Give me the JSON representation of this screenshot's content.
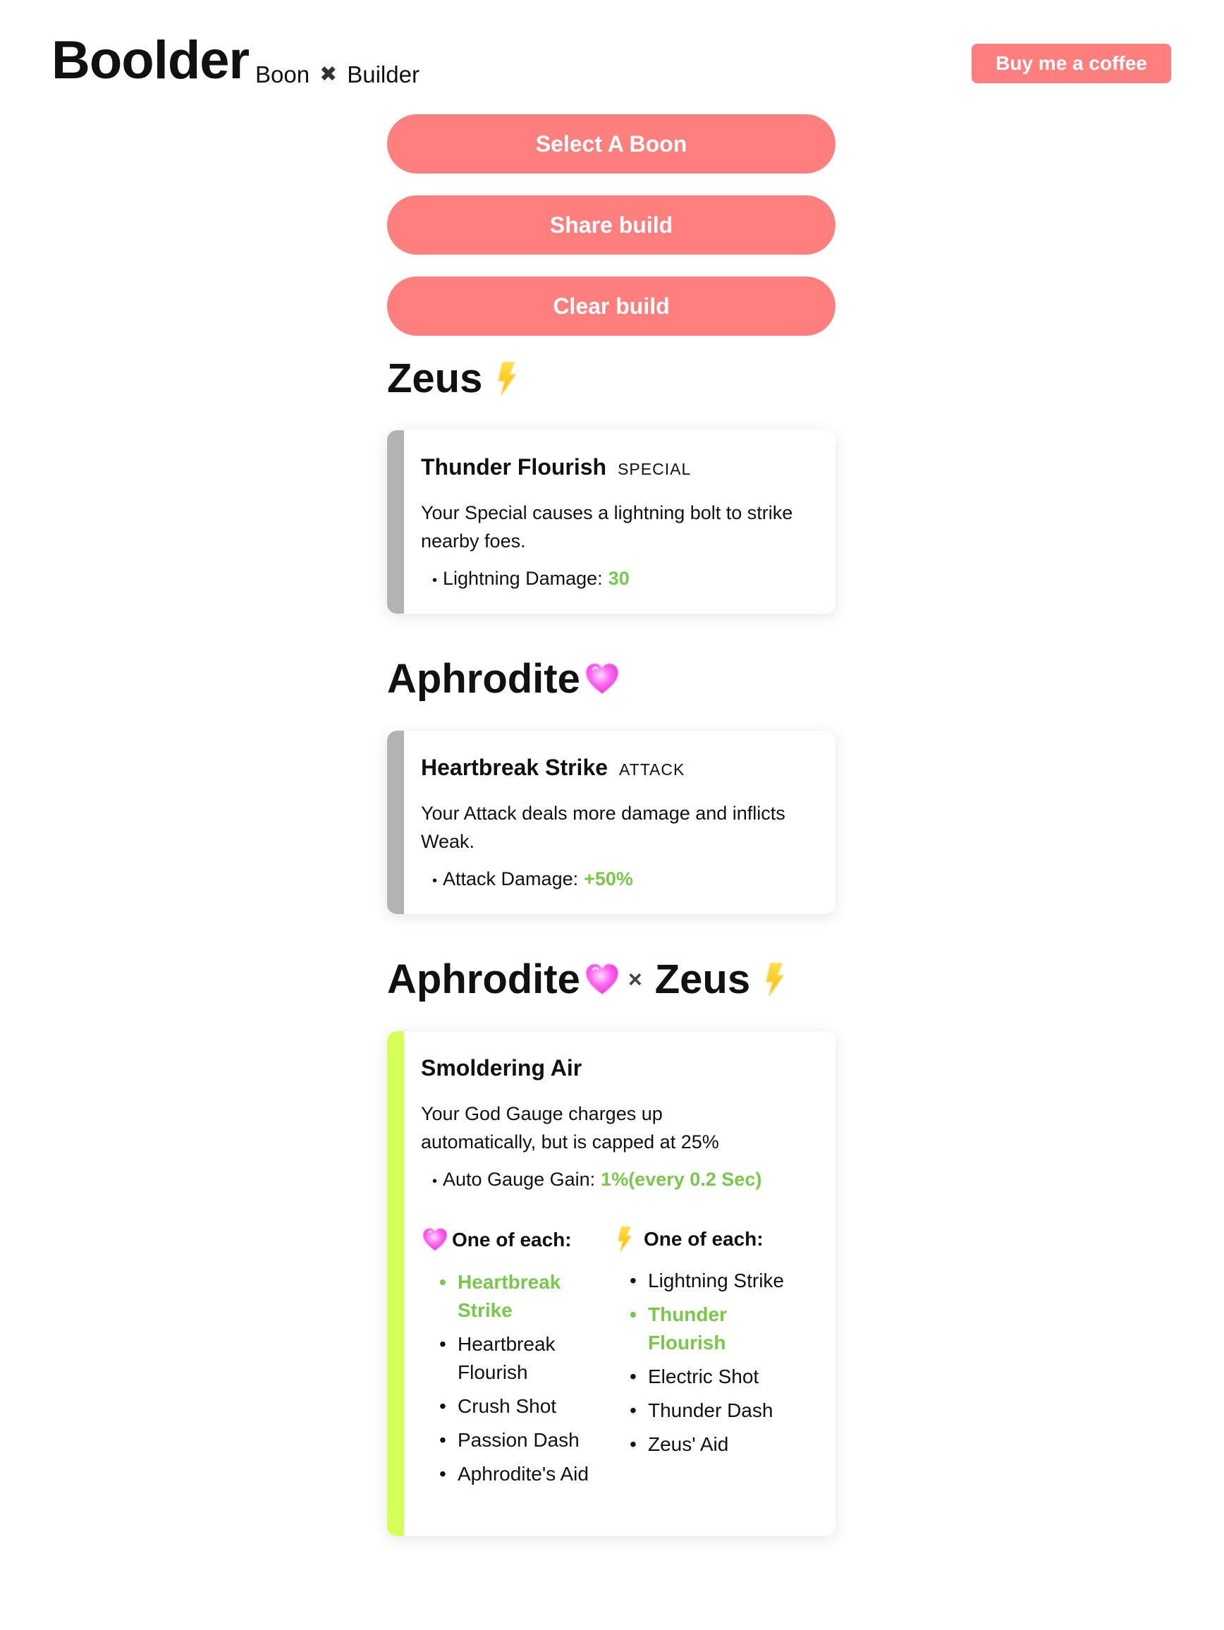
{
  "header": {
    "logo": "Boolder",
    "tagline_left": "Boon",
    "tagline_sep": "✖",
    "tagline_right": "Builder",
    "coffee_button": "Buy me a coffee"
  },
  "actions": {
    "select_boon": "Select A Boon",
    "share_build": "Share build",
    "clear_build": "Clear build"
  },
  "sections": {
    "zeus": {
      "god": "Zeus",
      "icon": "lightning-icon",
      "boon": {
        "name": "Thunder Flourish",
        "slot": "SPECIAL",
        "description": "Your Special causes a lightning bolt to strike nearby foes.",
        "stat_label": "Lightning Damage:",
        "stat_value": "30"
      }
    },
    "aphrodite": {
      "god": "Aphrodite",
      "icon": "heart-icon",
      "boon": {
        "name": "Heartbreak Strike",
        "slot": "ATTACK",
        "description": "Your Attack deals more damage and inflicts Weak.",
        "stat_label": "Attack Damage:",
        "stat_value": "+50%"
      }
    },
    "duo": {
      "god_a": "Aphrodite",
      "separator": "×",
      "god_b": "Zeus",
      "boon": {
        "name": "Smoldering Air",
        "description": "Your God Gauge charges up automatically, but is capped at 25%",
        "stat_label": "Auto Gauge Gain:",
        "stat_value": "1%(every 0.2 Sec)"
      },
      "requirements": {
        "left_heading": "One of each:",
        "left_items": [
          {
            "label": "Heartbreak Strike",
            "active": true
          },
          {
            "label": "Heartbreak Flourish",
            "active": false
          },
          {
            "label": "Crush Shot",
            "active": false
          },
          {
            "label": "Passion Dash",
            "active": false
          },
          {
            "label": "Aphrodite's Aid",
            "active": false
          }
        ],
        "right_heading": "One of each:",
        "right_items": [
          {
            "label": "Lightning Strike",
            "active": false
          },
          {
            "label": "Thunder Flourish",
            "active": true
          },
          {
            "label": "Electric Shot",
            "active": false
          },
          {
            "label": "Thunder Dash",
            "active": false
          },
          {
            "label": "Zeus' Aid",
            "active": false
          }
        ]
      }
    }
  },
  "colors": {
    "accent": "#ff7f7f",
    "highlight": "#78c84a",
    "duo_bar": "#d6ff5a",
    "card_bar": "#b3b3b3"
  }
}
